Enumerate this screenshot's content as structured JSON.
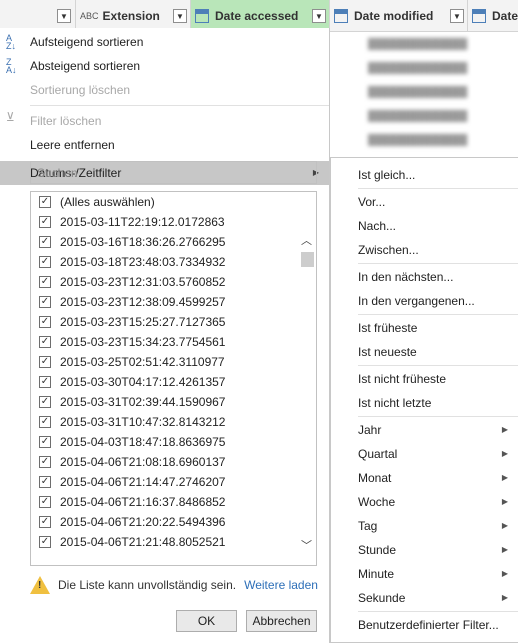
{
  "header": {
    "col_prev_label": "",
    "extension_label": "Extension",
    "extension_type_icon": "ABC",
    "date_accessed_label": "Date accessed",
    "date_modified_label": "Date modified",
    "date_truncated_label": "Date"
  },
  "menu": {
    "sort_asc": "Aufsteigend sortieren",
    "sort_desc": "Absteigend sortieren",
    "clear_sort": "Sortierung löschen",
    "clear_filter": "Filter löschen",
    "remove_empty": "Leere entfernen",
    "date_filter": "Datums-/Zeitfilter"
  },
  "search": {
    "placeholder": "Suchen"
  },
  "list": {
    "items": [
      "(Alles auswählen)",
      "2015-03-11T22:19:12.0172863",
      "2015-03-16T18:36:26.2766295",
      "2015-03-18T23:48:03.7334932",
      "2015-03-23T12:31:03.5760852",
      "2015-03-23T12:38:09.4599257",
      "2015-03-23T15:25:27.7127365",
      "2015-03-23T15:34:23.7754561",
      "2015-03-25T02:51:42.3110977",
      "2015-03-30T04:17:12.4261357",
      "2015-03-31T02:39:44.1590967",
      "2015-03-31T10:47:32.8143212",
      "2015-04-03T18:47:18.8636975",
      "2015-04-06T21:08:18.6960137",
      "2015-04-06T21:14:47.2746207",
      "2015-04-06T21:16:37.8486852",
      "2015-04-06T21:20:22.5494396",
      "2015-04-06T21:21:48.8052521"
    ]
  },
  "warning": {
    "text": "Die Liste kann unvollständig sein.",
    "link": "Weitere laden"
  },
  "buttons": {
    "ok": "OK",
    "cancel": "Abbrechen"
  },
  "submenu": {
    "items": [
      {
        "label": "Ist gleich...",
        "arrow": false
      },
      {
        "sep": true
      },
      {
        "label": "Vor...",
        "arrow": false
      },
      {
        "label": "Nach...",
        "arrow": false
      },
      {
        "label": "Zwischen...",
        "arrow": false
      },
      {
        "sep": true
      },
      {
        "label": "In den nächsten...",
        "arrow": false
      },
      {
        "label": "In den vergangenen...",
        "arrow": false
      },
      {
        "sep": true
      },
      {
        "label": "Ist früheste",
        "arrow": false
      },
      {
        "label": "Ist neueste",
        "arrow": false
      },
      {
        "sep": true
      },
      {
        "label": "Ist nicht früheste",
        "arrow": false
      },
      {
        "label": "Ist nicht letzte",
        "arrow": false
      },
      {
        "sep": true
      },
      {
        "label": "Jahr",
        "arrow": true
      },
      {
        "label": "Quartal",
        "arrow": true
      },
      {
        "label": "Monat",
        "arrow": true
      },
      {
        "label": "Woche",
        "arrow": true
      },
      {
        "label": "Tag",
        "arrow": true
      },
      {
        "label": "Stunde",
        "arrow": true
      },
      {
        "label": "Minute",
        "arrow": true
      },
      {
        "label": "Sekunde",
        "arrow": true
      },
      {
        "sep": true
      },
      {
        "label": "Benutzerdefinierter Filter...",
        "arrow": false
      }
    ]
  },
  "colors": {
    "active_header": "#b9e6b9",
    "link": "#2d6fb8",
    "warning": "#f0c040"
  }
}
